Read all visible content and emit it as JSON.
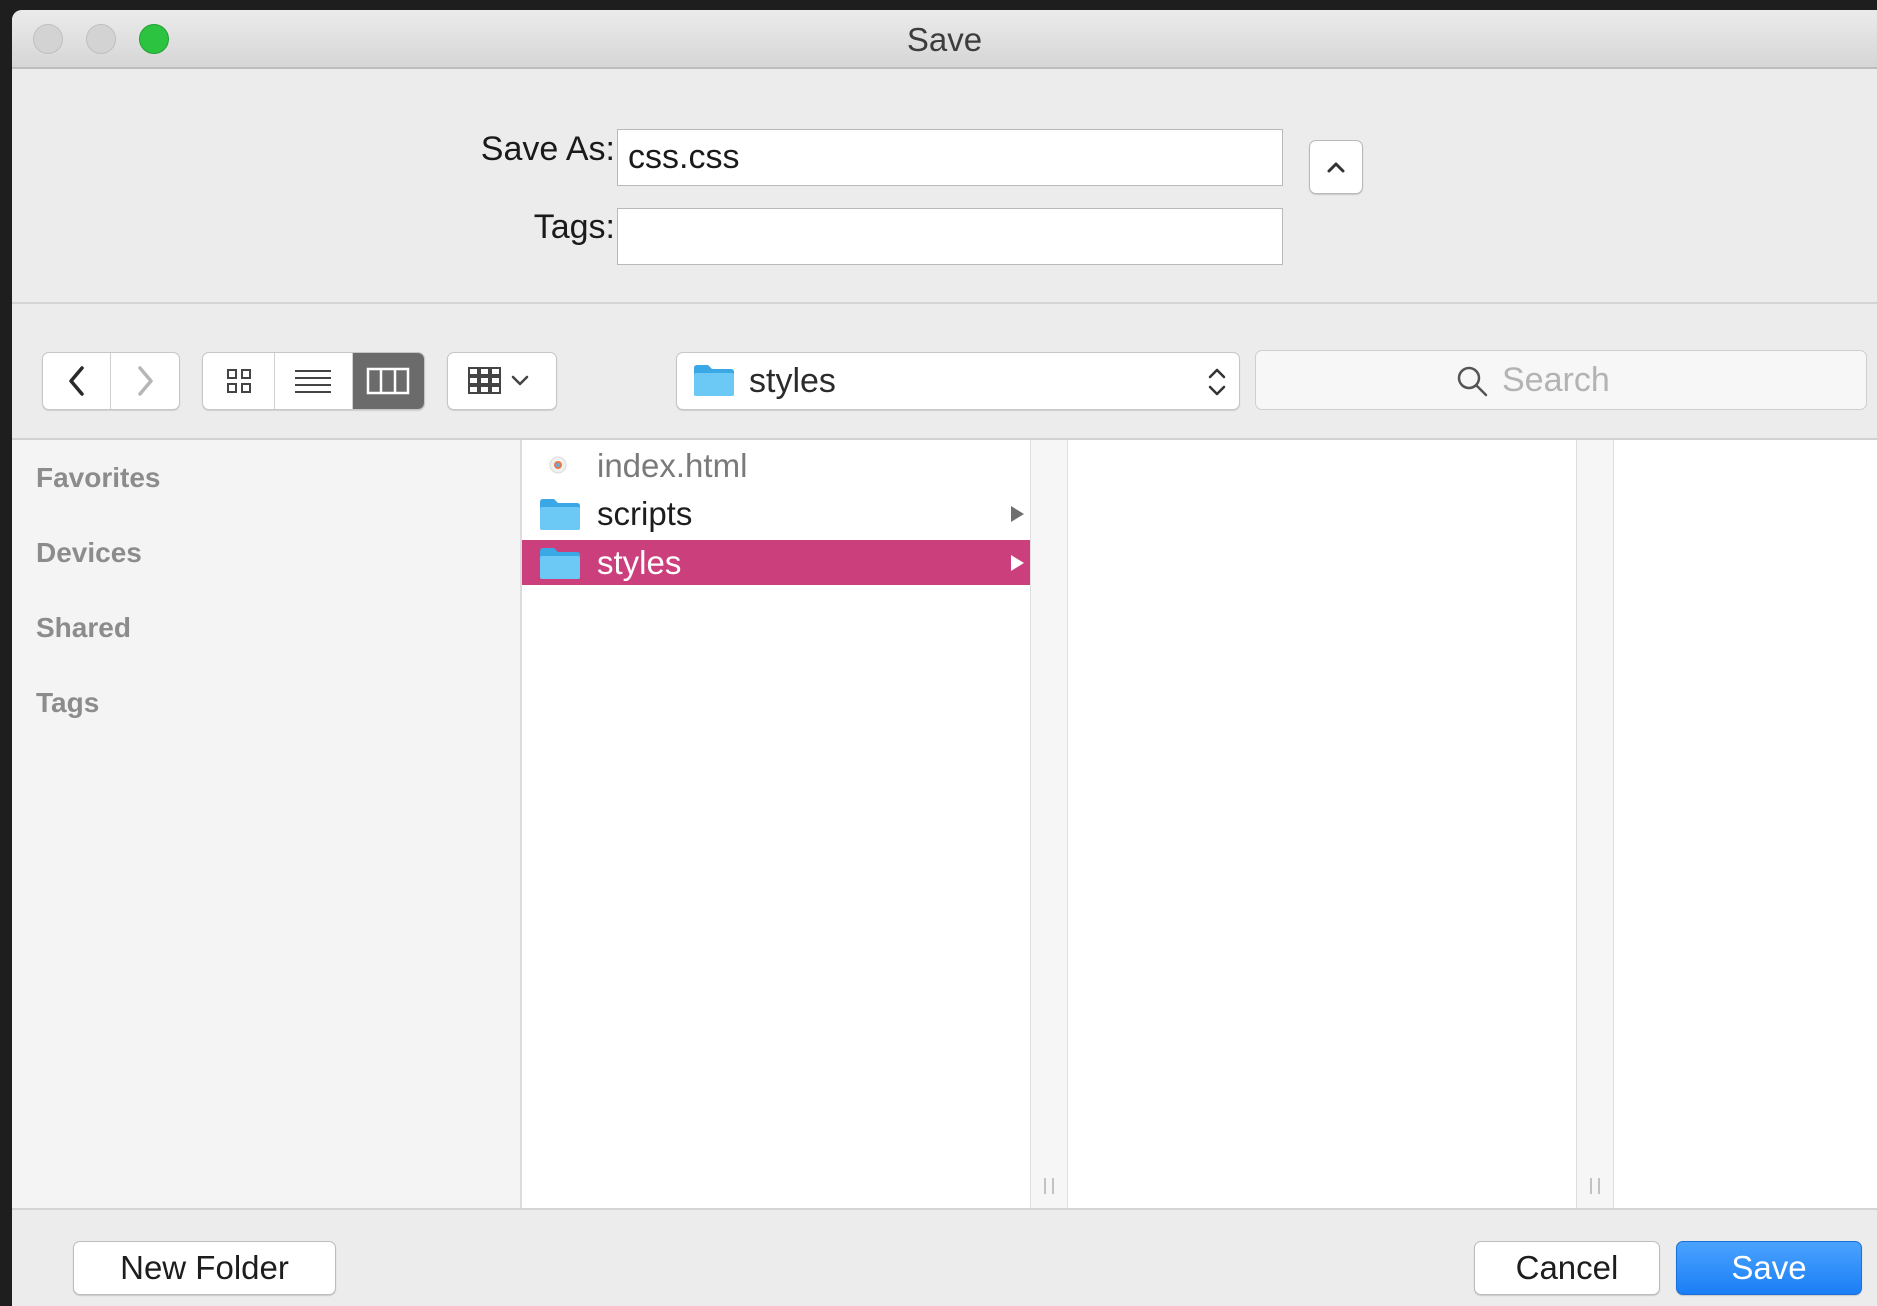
{
  "window": {
    "title": "Save"
  },
  "form": {
    "save_as_label": "Save As:",
    "save_as_value": "css.css",
    "tags_label": "Tags:",
    "tags_value": ""
  },
  "toolbar": {
    "back_icon": "chevron-left-icon",
    "forward_icon": "chevron-right-icon",
    "view_modes": [
      "icon-view",
      "list-view",
      "column-view"
    ],
    "active_view": "column-view",
    "arrange_icon": "arrange-icon",
    "location": "styles",
    "search_placeholder": "Search"
  },
  "sidebar": {
    "items": [
      {
        "label": "Favorites"
      },
      {
        "label": "Devices"
      },
      {
        "label": "Shared"
      },
      {
        "label": "Tags"
      }
    ]
  },
  "browser": {
    "column1": [
      {
        "name": "index.html",
        "type": "file",
        "dimmed": true
      },
      {
        "name": "scripts",
        "type": "folder"
      },
      {
        "name": "styles",
        "type": "folder",
        "selected": true
      }
    ]
  },
  "footer": {
    "new_folder": "New Folder",
    "cancel": "Cancel",
    "save": "Save"
  },
  "colors": {
    "selection": "#cb3f7d",
    "primary_button": "#1a7ef5",
    "zoom_button": "#2bc33f",
    "folder": "#5ec2f2"
  }
}
